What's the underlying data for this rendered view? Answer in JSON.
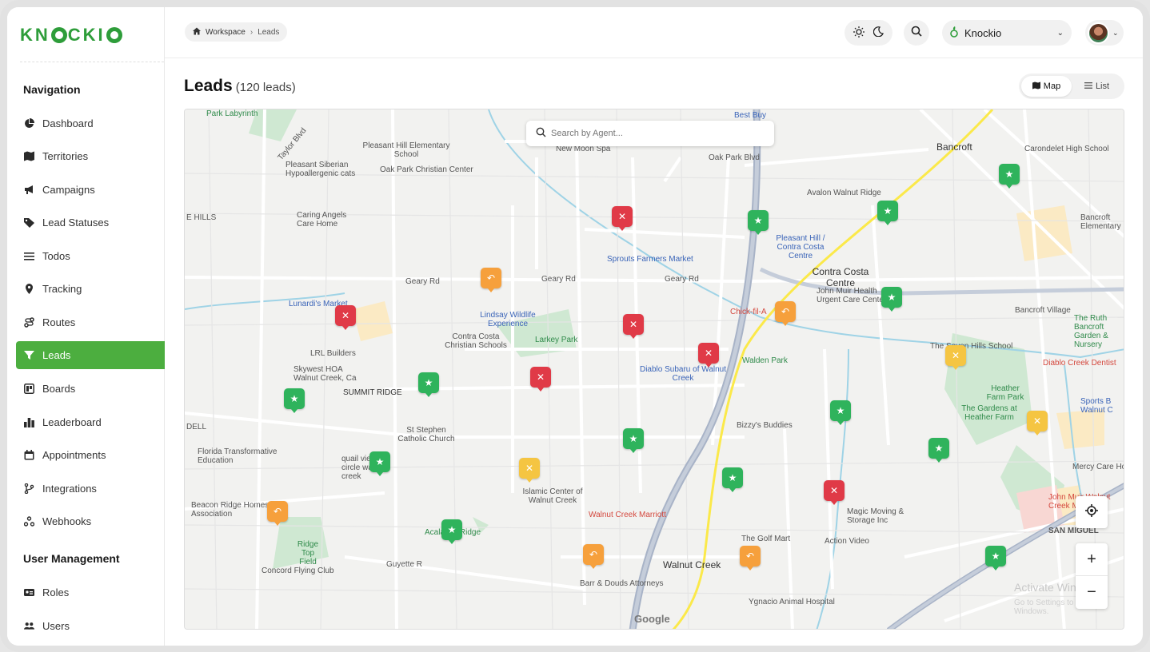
{
  "brand": {
    "logo_text": "KNOCKIO"
  },
  "sidebar": {
    "navigation_heading": "Navigation",
    "items": [
      {
        "label": "Dashboard",
        "icon": "pie-chart-icon"
      },
      {
        "label": "Territories",
        "icon": "map-icon"
      },
      {
        "label": "Campaigns",
        "icon": "megaphone-icon"
      },
      {
        "label": "Lead Statuses",
        "icon": "tag-icon"
      },
      {
        "label": "Todos",
        "icon": "list-icon"
      },
      {
        "label": "Tracking",
        "icon": "location-pin-icon"
      },
      {
        "label": "Routes",
        "icon": "route-icon"
      },
      {
        "label": "Leads",
        "icon": "filter-icon",
        "active": true
      },
      {
        "label": "Boards",
        "icon": "board-icon"
      },
      {
        "label": "Leaderboard",
        "icon": "bar-chart-icon"
      },
      {
        "label": "Appointments",
        "icon": "calendar-icon"
      },
      {
        "label": "Integrations",
        "icon": "branch-icon"
      },
      {
        "label": "Webhooks",
        "icon": "webhook-icon"
      }
    ],
    "user_management_heading": "User Management",
    "user_items": [
      {
        "label": "Roles",
        "icon": "id-card-icon"
      },
      {
        "label": "Users",
        "icon": "users-icon"
      }
    ]
  },
  "header": {
    "breadcrumb": [
      "Workspace",
      "Leads"
    ],
    "workspace_name": "Knockio"
  },
  "page": {
    "title": "Leads",
    "count_label": "(120 leads)",
    "view_map": "Map",
    "view_list": "List"
  },
  "map": {
    "search_placeholder": "Search by Agent...",
    "labels": {
      "park_labyrinth": "Park Labyrinth",
      "taylor_blvd": "Taylor Blvd",
      "pleasant_hill_es": "Pleasant Hill Elementary School",
      "new_moon_spa": "New Moon Spa",
      "oak_park_blvd": "Oak Park Blvd",
      "best_buy": "Best Buy",
      "bancroft": "Bancroft",
      "carondelet": "Carondelet High School",
      "pleasant_siberian": "Pleasant Siberian Hypoallergenic cats",
      "oak_park_christian": "Oak Park Christian Center",
      "avalon": "Avalon Walnut Ridge",
      "caring_angels": "Caring Angels Care Home",
      "e_hills": "E HILLS",
      "pleasant_hill_bart": "Pleasant Hill / Contra Costa Centre",
      "bancroft_elem": "Bancroft Elementary",
      "sprouts": "Sprouts Farmers Market",
      "geary_rd": "Geary Rd",
      "contra_costa_centre": "Contra Costa Centre",
      "john_muir": "John Muir Health Urgent Care Center",
      "lunardis": "Lunardi's Market",
      "lindsay": "Lindsay Wildlife Experience",
      "larkey_park": "Larkey Park",
      "chick_fil_a": "Chick-fil-A",
      "bancroft_village": "Bancroft Village",
      "ruth_bancroft": "The Ruth Bancroft Garden & Nursery",
      "contra_costa_christian": "Contra Costa Christian Schools",
      "walden_park": "Walden Park",
      "shell_ridge": "The Seven Hills School",
      "diablo_creek": "Diablo Creek Dentist",
      "lrl_builders": "LRL Builders",
      "skywest": "Skywest HOA Walnut Creek, Ca",
      "diablo_subaru": "Diablo Subaru of Walnut Creek",
      "summit_ridge": "SUMMIT RIDGE",
      "heather_farm": "Heather Farm Park",
      "gardens": "The Gardens at Heather Farm",
      "sports_basement": "Sports B Walnut C",
      "st_stephen": "St Stephen Catholic Church",
      "bizzys": "Bizzy's Buddies",
      "dell": "DELL",
      "florida_transform": "Florida Transformative Education",
      "quail_view": "quail view circle walnut creek",
      "islamic_center": "Islamic Center of Walnut Creek",
      "mercy": "Mercy Care Hom",
      "beacon_ridge": "Beacon Ridge Homes Association",
      "magic_moving": "Magic Moving & Storage Inc",
      "john_muir_medical": "John Muir Walnut Creek Medical",
      "walnut_creek_marriott": "Walnut Creek Marriott",
      "san_miguel": "SAN MIGUEL",
      "ridge_top": "Ridge Top Field",
      "the_golf_mart": "The Golf Mart",
      "action_video": "Action Video",
      "concord_flying": "Concord Flying Club",
      "walnut_creek": "Walnut Creek",
      "guyette": "Guyette R",
      "barr_douds": "Barr & Douds Attorneys",
      "ygnacio_animal": "Ygnacio Animal Hospital",
      "acalanes_ridge": "Acalanes Ridge",
      "google": "Google",
      "activate_windows": "Activate Windows",
      "activate_windows_sub": "Go to Settings to activate Windows."
    }
  }
}
